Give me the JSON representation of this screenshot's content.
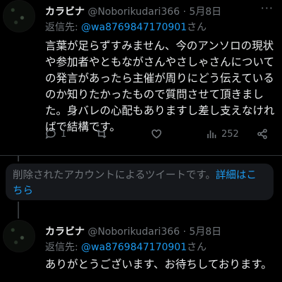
{
  "tweets": [
    {
      "name": "カラビナ",
      "handle": "@Noborikudari366",
      "sep": "·",
      "date": "5月8日",
      "reply_prefix": "返信先: ",
      "reply_handle": "@wa8769847170901",
      "reply_suffix": "さん",
      "text": "言葉が足らずすみません、今のアンソロの現状や参加者やともながさんやさしゃさんについての発言があったら主催が周りにどう伝えているのか知りたかったもので質問させて頂きました。身バレの心配もありますし差し支えなければで結構です。",
      "replies": "1",
      "views": "252"
    },
    {
      "name": "カラビナ",
      "handle": "@Noborikudari366",
      "sep": "·",
      "date": "5月8日",
      "reply_prefix": "返信先: ",
      "reply_handle": "@wa8769847170901",
      "reply_suffix": "さん",
      "text": "ありがとうございます、お待ちしております。"
    }
  ],
  "deleted_notice": {
    "text": "削除されたアカウントによるツイートです。",
    "link": "詳細はこちら"
  },
  "icons": [
    "more-icon",
    "reply-icon",
    "retweet-icon",
    "like-icon",
    "views-icon",
    "share-icon"
  ],
  "colors": {
    "accent": "#1d9bf0",
    "muted": "#71767b",
    "text": "#e7e9ea",
    "background": "#000000"
  }
}
